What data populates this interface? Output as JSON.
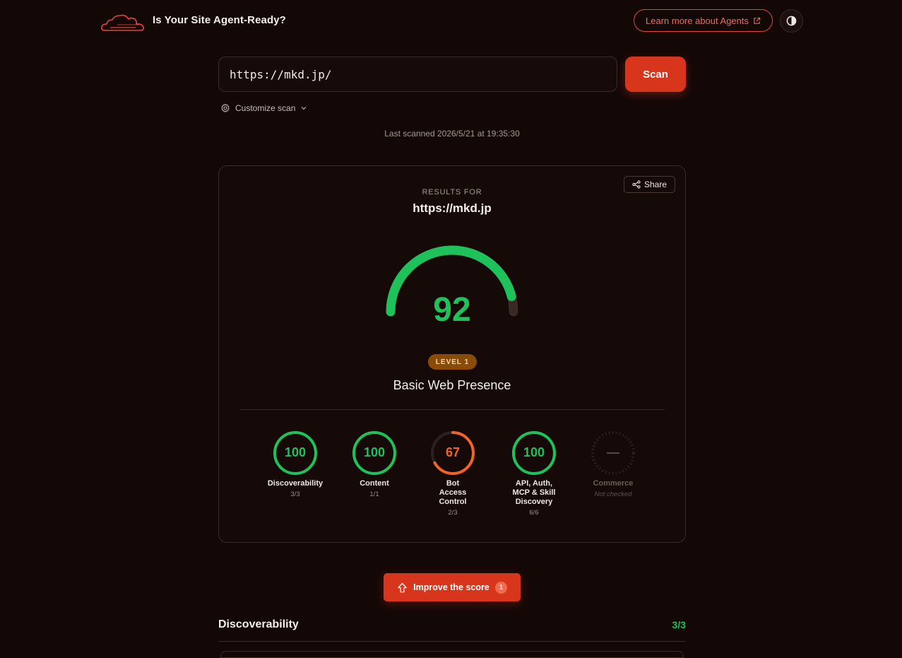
{
  "header": {
    "title": "Is Your Site Agent-Ready?",
    "learn_more": "Learn more about Agents",
    "brand_color": "#e0473a"
  },
  "search": {
    "url_value": "https://mkd.jp/",
    "scan_label": "Scan",
    "customize_label": "Customize scan",
    "last_scanned": "Last scanned 2026/5/21 at 19:35:30"
  },
  "results": {
    "results_for_label": "RESULTS FOR",
    "url": "https://mkd.jp",
    "share_label": "Share",
    "score": "92",
    "score_value": 92,
    "score_max": 100,
    "level_badge": "LEVEL 1",
    "level_name": "Basic Web Presence",
    "score_color": "#1fc15a",
    "categories": [
      {
        "score": "100",
        "value": 100,
        "label": "Discoverability",
        "sub": "3/3",
        "color": "#1fc15a"
      },
      {
        "score": "100",
        "value": 100,
        "label": "Content",
        "sub": "1/1",
        "color": "#1fc15a"
      },
      {
        "score": "67",
        "value": 67,
        "label": "Bot Access Control",
        "sub": "2/3",
        "color": "#f0642a"
      },
      {
        "score": "100",
        "value": 100,
        "label": "API, Auth, MCP & Skill Discovery",
        "sub": "6/6",
        "color": "#1fc15a"
      },
      {
        "score": "—",
        "value": 0,
        "label": "Commerce",
        "sub": "Not checked",
        "color": "#5a4d49"
      }
    ]
  },
  "improve": {
    "label": "Improve the score",
    "count": "1"
  },
  "sections": [
    {
      "title": "Discoverability",
      "score": "3/3"
    }
  ]
}
